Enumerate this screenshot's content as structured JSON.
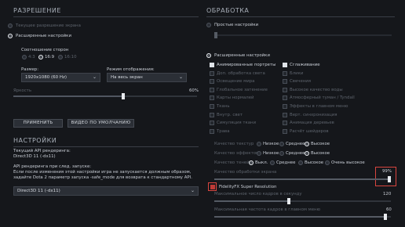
{
  "left": {
    "resolution": {
      "title": "РАЗРЕШЕНИЕ",
      "current_res": "Текущее разрешение экрана",
      "advanced": "Расширенные настройки",
      "aspect_title": "Соотношение сторон",
      "aspect_options": [
        "4:3",
        "16:9",
        "16:10"
      ],
      "size_label": "Размер:",
      "size_value": "1920x1080 (60 Hz)",
      "mode_label": "Режим отображения:",
      "mode_value": "На весь экран",
      "brightness_label": "Яркость",
      "brightness_value": "60%",
      "brightness_level": 0.6,
      "apply_button": "ПРИМЕНИТЬ",
      "default_button": "ВИДЕО ПО УМОЛЧАНИЮ"
    },
    "settings": {
      "title": "НАСТРОЙКИ",
      "api_current_label": "Текущий API рендеринга:",
      "api_current_value": "Direct3D 11 (-dx11)",
      "api_next_label": "API рендеринга при след. запуске:",
      "api_note": "Если после изменения этой настройки игра не запускается должным образом, задайте Dota 2 параметр запуска -safe_mode для возврата к стандартному API.",
      "api_select": "Direct3D 11 (-dx11)"
    }
  },
  "right": {
    "title": "ОБРАБОТКА",
    "simple": "Простые настройки",
    "advanced": "Расширенные настройки",
    "checkboxes_col1": [
      {
        "label": "Анимированные портреты",
        "on": true
      },
      {
        "label": "Доп. обработка света",
        "on": false
      },
      {
        "label": "Освещение мира",
        "on": false
      },
      {
        "label": "Глобальное затенение",
        "on": false
      },
      {
        "label": "Карты нормалей",
        "on": false
      },
      {
        "label": "Ткань",
        "on": false
      },
      {
        "label": "Внутр. свет",
        "on": false
      },
      {
        "label": "Симуляция ткани",
        "on": false
      },
      {
        "label": "Трава",
        "on": false
      }
    ],
    "checkboxes_col2": [
      {
        "label": "Сглаживание",
        "on": true
      },
      {
        "label": "Блики",
        "on": false
      },
      {
        "label": "Свечения",
        "on": false
      },
      {
        "label": "Высокое качество воды",
        "on": false
      },
      {
        "label": "Атмосферный туман / Tyndall",
        "on": false
      },
      {
        "label": "Эффекты в главном меню",
        "on": false
      },
      {
        "label": "Верт. синхронизация",
        "on": false
      },
      {
        "label": "Анимация деревьев",
        "on": false
      },
      {
        "label": "Расчёт шейдеров",
        "on": false
      }
    ],
    "texture_label": "Качество текстур",
    "texture_options": [
      "Низкое",
      "Среднее",
      "Высокое"
    ],
    "effects_label": "Качество эффектов",
    "effects_options": [
      "Низкое",
      "Среднее",
      "Высокое"
    ],
    "shadows_label": "Качество теней",
    "shadows_options": [
      "Выкл.",
      "Среднее",
      "Высокое",
      "Очень высокое"
    ],
    "render_quality_label": "Качество обработки экрана",
    "render_quality_value": "99%",
    "render_quality_level": 0.99,
    "fsr_label": "FidelityFX Super Resolution",
    "max_fps_label": "Максимальное число кадров в секунду",
    "max_fps_value": "120",
    "max_fps_level": 0.42,
    "menu_fps_label": "Максимальная частота кадров в главном меню",
    "menu_fps_value": "60",
    "menu_fps_level": 0.97
  }
}
